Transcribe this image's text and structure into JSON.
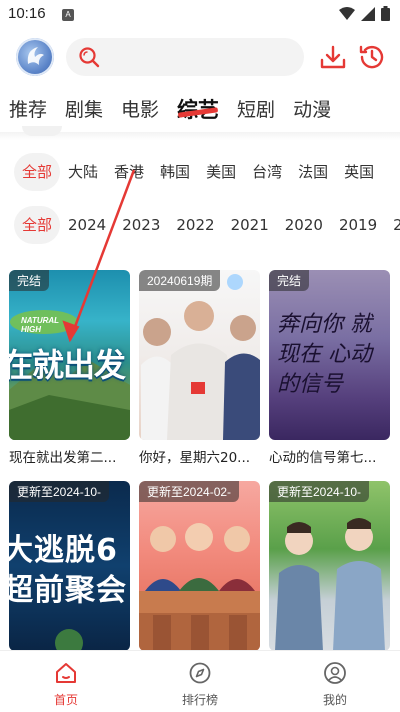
{
  "status": {
    "time": "10:16",
    "badge": "A"
  },
  "search": {
    "placeholder": ""
  },
  "tabs": [
    "推荐",
    "剧集",
    "电影",
    "综艺",
    "短剧",
    "动漫"
  ],
  "active_tab": "综艺",
  "region_filters": [
    "全部",
    "大陆",
    "香港",
    "韩国",
    "美国",
    "台湾",
    "法国",
    "英国"
  ],
  "year_filters": [
    "全部",
    "2024",
    "2023",
    "2022",
    "2021",
    "2020",
    "2019",
    "2"
  ],
  "cards": [
    {
      "badge": "完结",
      "title": "现在就出发第二...",
      "poster_text": "在就出发"
    },
    {
      "badge": "20240619期",
      "title": "你好，星期六20...",
      "poster_text": ""
    },
    {
      "badge": "完结",
      "title": "心动的信号第七...",
      "poster_text": "奔向你 就现在 心动的信号"
    },
    {
      "badge": "更新至2024-10-",
      "title": "",
      "poster_text": "大逃脱6 超前聚会"
    },
    {
      "badge": "更新至2024-02-",
      "title": "",
      "poster_text": ""
    },
    {
      "badge": "更新至2024-10-",
      "title": "",
      "poster_text": ""
    }
  ],
  "poster_logo_text": "NATURAL HIGH",
  "bottom_nav": [
    {
      "label": "首页",
      "icon": "home-icon"
    },
    {
      "label": "排行榜",
      "icon": "compass-icon"
    },
    {
      "label": "我的",
      "icon": "user-icon"
    }
  ],
  "colors": {
    "accent": "#e53935"
  }
}
